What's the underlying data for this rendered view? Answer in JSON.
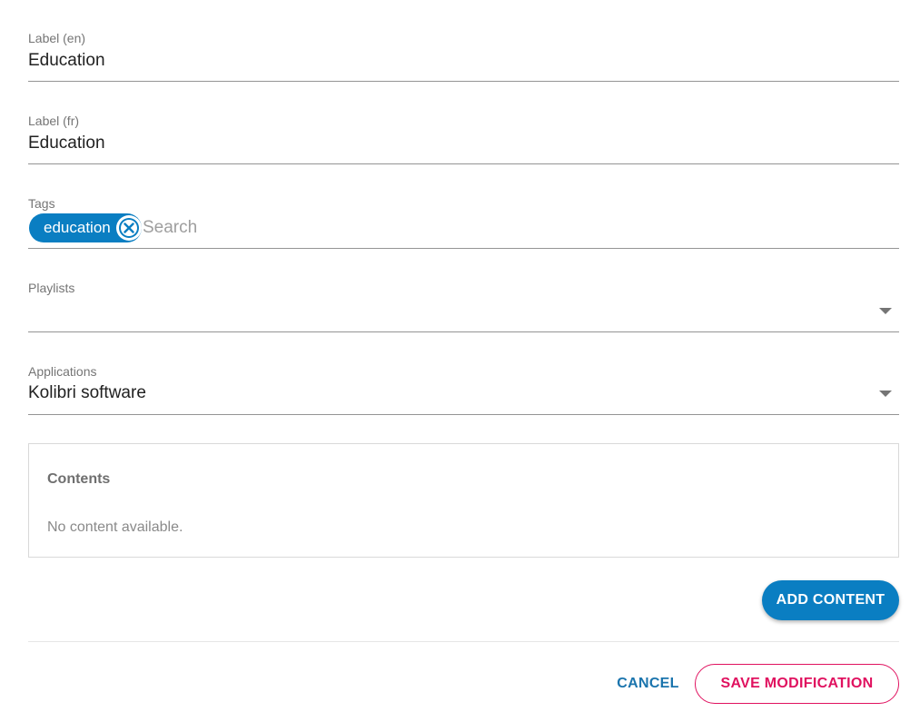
{
  "form": {
    "label_en": {
      "label": "Label (en)",
      "value": "Education"
    },
    "label_fr": {
      "label": "Label (fr)",
      "value": "Education"
    },
    "tags": {
      "label": "Tags",
      "chips": [
        "education"
      ],
      "search_placeholder": "Search"
    },
    "playlists": {
      "label": "Playlists",
      "value": ""
    },
    "applications": {
      "label": "Applications",
      "value": "Kolibri software"
    }
  },
  "contents": {
    "title": "Contents",
    "empty_text": "No content available.",
    "add_label": "ADD CONTENT"
  },
  "actions": {
    "cancel_label": "CANCEL",
    "save_label": "SAVE MODIFICATION"
  },
  "colors": {
    "primary": "#0a7ec2",
    "accent": "#e0115f",
    "underline": "#949494"
  },
  "icons": {
    "chip_remove": "close-circle-icon",
    "dropdown": "caret-down-icon"
  }
}
